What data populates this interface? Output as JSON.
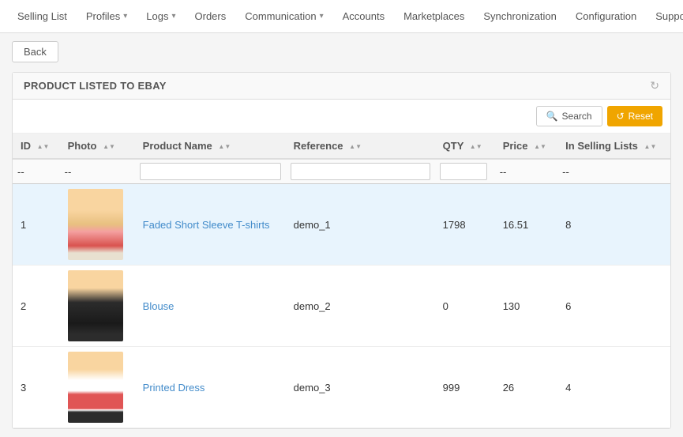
{
  "nav": {
    "items": [
      {
        "label": "Selling List",
        "has_dropdown": false
      },
      {
        "label": "Profiles",
        "has_dropdown": true
      },
      {
        "label": "Logs",
        "has_dropdown": true
      },
      {
        "label": "Orders",
        "has_dropdown": false
      },
      {
        "label": "Communication",
        "has_dropdown": true
      },
      {
        "label": "Accounts",
        "has_dropdown": false
      },
      {
        "label": "Marketplaces",
        "has_dropdown": false
      },
      {
        "label": "Synchronization",
        "has_dropdown": false
      },
      {
        "label": "Configuration",
        "has_dropdown": false
      }
    ],
    "support_label": "Support"
  },
  "back_button_label": "Back",
  "panel": {
    "title": "PRODUCT LISTED TO EBAY",
    "search_button_label": "Search",
    "reset_button_label": "Reset"
  },
  "table": {
    "columns": [
      {
        "key": "id",
        "label": "ID"
      },
      {
        "key": "photo",
        "label": "Photo"
      },
      {
        "key": "product_name",
        "label": "Product Name"
      },
      {
        "key": "reference",
        "label": "Reference"
      },
      {
        "key": "qty",
        "label": "QTY"
      },
      {
        "key": "price",
        "label": "Price"
      },
      {
        "key": "in_selling_lists",
        "label": "In Selling Lists"
      }
    ],
    "filter_row": {
      "id_placeholder": "--",
      "photo_placeholder": "--",
      "product_name_placeholder": "",
      "reference_placeholder": "",
      "qty_placeholder": "",
      "price_placeholder": "--",
      "in_selling_lists_placeholder": "--"
    },
    "rows": [
      {
        "id": "1",
        "photo_figure": "figure-1",
        "product_name": "Faded Short Sleeve T-shirts",
        "reference": "demo_1",
        "qty": "1798",
        "price": "16.51",
        "in_selling_lists": "8"
      },
      {
        "id": "2",
        "photo_figure": "figure-2",
        "product_name": "Blouse",
        "reference": "demo_2",
        "qty": "0",
        "price": "130",
        "in_selling_lists": "6"
      },
      {
        "id": "3",
        "photo_figure": "figure-3",
        "product_name": "Printed Dress",
        "reference": "demo_3",
        "qty": "999",
        "price": "26",
        "in_selling_lists": "4"
      }
    ]
  }
}
